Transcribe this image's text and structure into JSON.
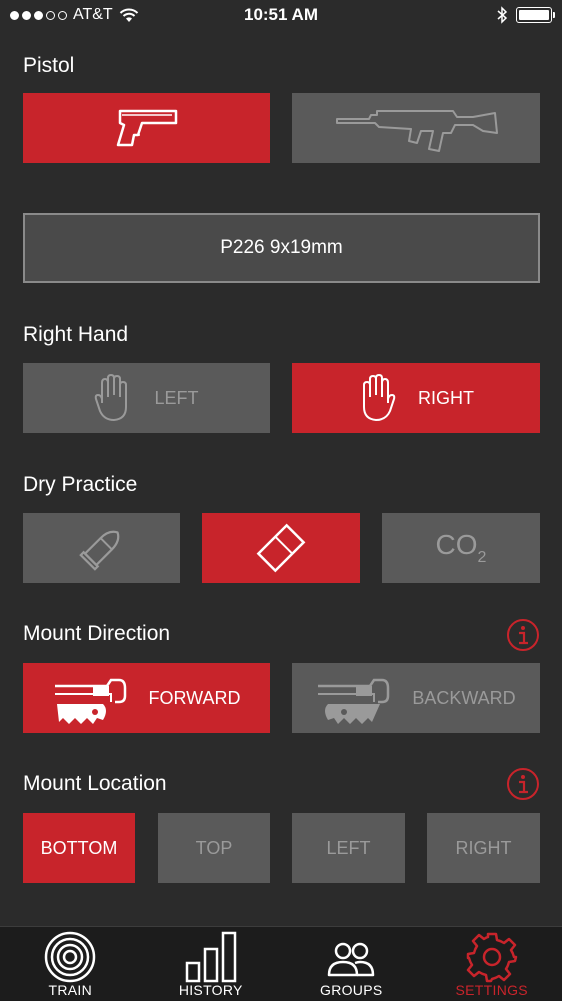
{
  "status_bar": {
    "carrier": "AT&T",
    "time": "10:51 AM"
  },
  "weapon": {
    "label": "Pistol",
    "options": [
      "pistol",
      "rifle"
    ],
    "selected": "pistol"
  },
  "ammo": {
    "value": "P226 9x19mm"
  },
  "hand": {
    "label": "Right Hand",
    "left": "LEFT",
    "right": "RIGHT",
    "selected": "right"
  },
  "dry_practice": {
    "label": "Dry Practice",
    "co2_main": "CO",
    "co2_sub": "2",
    "selected": "insert"
  },
  "mount_direction": {
    "label": "Mount Direction",
    "forward": "FORWARD",
    "backward": "BACKWARD",
    "selected": "forward"
  },
  "mount_location": {
    "label": "Mount Location",
    "bottom": "BOTTOM",
    "top": "TOP",
    "left": "LEFT",
    "right": "RIGHT",
    "selected": "bottom"
  },
  "tabs": {
    "train": "TRAIN",
    "history": "HISTORY",
    "groups": "GROUPS",
    "settings": "SETTINGS",
    "active": "settings"
  },
  "colors": {
    "accent": "#c8242b",
    "background": "#2b2b2b",
    "button_off": "#5a5a5a"
  }
}
